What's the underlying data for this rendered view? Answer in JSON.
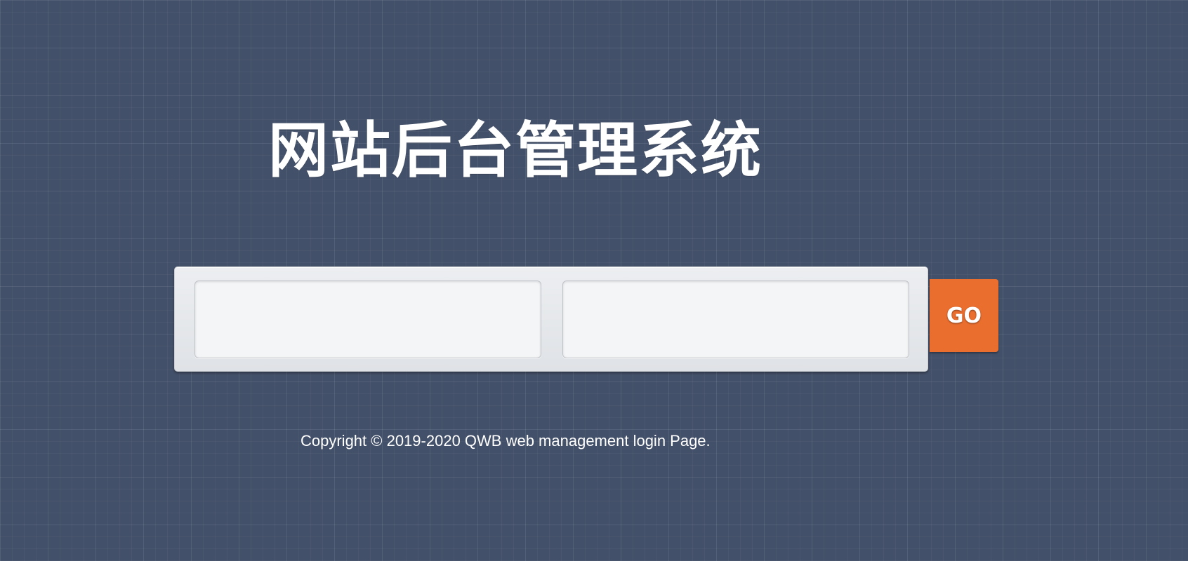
{
  "page": {
    "title": "网站后台管理系统",
    "background_color": "#435069"
  },
  "login_form": {
    "username": {
      "value": "",
      "placeholder": ""
    },
    "password": {
      "value": "",
      "placeholder": ""
    },
    "submit_label": "GO",
    "submit_color": "#ea6e2e"
  },
  "footer": {
    "copyright": "Copyright © 2019-2020 QWB web management login Page."
  }
}
